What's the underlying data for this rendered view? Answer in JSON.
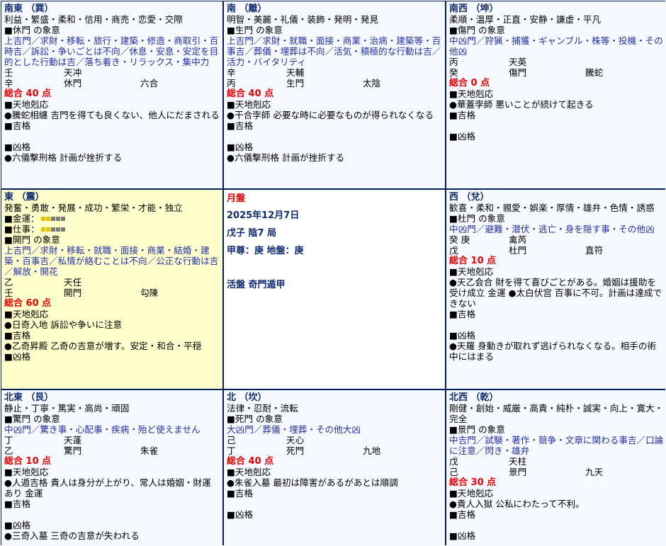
{
  "colors": {
    "border": "#00205a",
    "accent_blue": "#2130a8",
    "score_red": "#ee0000",
    "highlight": "#ffffcc",
    "luck_on": "#e8c400",
    "luck_off": "#7a7a7a"
  },
  "cells": {
    "se": {
      "title": "南東 （巽）",
      "traits": "利益・繁盛・柔和・信用・商売・恋愛・交際",
      "gate_label": "■休門 の象意",
      "gate_meaning": "上吉門／求財・移転・旅行・建築・修造・商取引・百時吉／訴訟・争いごとは不向／休息・安息・安定を目的とした行動は吉／落ち着き・リラックス・集中力",
      "row1": [
        "壬",
        "天冲",
        ""
      ],
      "row2": [
        "辛",
        "休門",
        "六合"
      ],
      "score": "総合 40 点",
      "kakusou": "■天地剋応",
      "kakusou_text": "●騰蛇相纏 吉門を得ても良くない、他人にだまされる",
      "kichi": "■吉格",
      "kichi_text": "",
      "kyou": "■凶格",
      "kyou_text": "●六儀撃刑格 計画が挫折する"
    },
    "s": {
      "title": "南 （離）",
      "traits": "明智・美麗・礼儀・装飾・発明・発見",
      "gate_label": "■生門 の象意",
      "gate_meaning": "上吉門／求財・就職・面接・商業・治病・建築等・百事吉／葬儀・埋葬は不向／活気・積極的な行動は吉／活力・バイタリティ",
      "row1": [
        "辛",
        "天輔",
        ""
      ],
      "row2": [
        "丙",
        "生門",
        "太陰"
      ],
      "score": "総合 40 点",
      "kakusou": "■天地剋応",
      "kakusou_text": "●干合孛師 必要な時に必要なものが得られなくなる",
      "kichi": "■吉格",
      "kichi_text": "",
      "kyou": "■凶格",
      "kyou_text": "●六儀撃刑格 計画が挫折する"
    },
    "sw": {
      "title": "南西 （坤）",
      "traits": "柔順・温厚・正直・安静・謙虚・平凡",
      "gate_label": "■傷門 の象意",
      "gate_meaning": "中凶門／狩猟・捕獲・ギャンブル・株等・投機・その他凶",
      "row1": [
        "丙",
        "天英",
        ""
      ],
      "row2": [
        "癸",
        "傷門",
        "騰蛇"
      ],
      "score": "総合 0 点",
      "kakusou": "■天地剋応",
      "kakusou_text": "●華蓋孛師 悪いことが続けて起きる",
      "kichi": "■吉格",
      "kichi_text": "",
      "kyou": "■凶格",
      "kyou_text": ""
    },
    "e": {
      "title": "東 （震）",
      "traits": "発奮・勇敢・発展・成功・繁栄・才能・独立",
      "luck1_label": "■金運：",
      "luck1_level": 2,
      "luck2_label": "■仕事：",
      "luck2_level": 2,
      "gate_label": "■開門 の象意",
      "gate_meaning": "上吉門／求財・移転・就職・面接・商業・結婚・建築・百事吉／私情が絡むことは不向／公正な行動は吉／解放・開花",
      "row1": [
        "乙",
        "天任",
        ""
      ],
      "row2": [
        "壬",
        "開門",
        "勾陳"
      ],
      "score": "総合 60 点",
      "kakusou": "■天地剋応",
      "kakusou_text": "●日奇入地 訴訟や争いに注意",
      "kichi": "■吉格",
      "kichi_text": "●乙奇昇殿 乙奇の吉意が増す。安定・和合・平穏",
      "kyou": "■凶格",
      "kyou_text": ""
    },
    "center": {
      "line1": "月盤",
      "line2": "2025年12月7日",
      "line3": "戊子 陰7 局",
      "line4": "甲尊：庚 地盤：庚",
      "line5": "活盤 奇門遁甲"
    },
    "w": {
      "title": "西 （兌）",
      "traits": "歓喜・柔和・親愛・娯楽・厚情・雄弁・色情・誘惑",
      "gate_label": "■杜門 の象意",
      "gate_meaning": "中凶門／避難・潜伏・逃亡・身を隠す事・その他凶",
      "row1": [
        "癸 庚",
        "禽芮",
        ""
      ],
      "row2": [
        "戊",
        "杜門",
        "直符"
      ],
      "score": "総合 10 点",
      "kakusou": "■天地剋応",
      "kakusou_text": "●天乙会合 財を得て喜びごとがある。婚姻は援助を受け成立 金運 ●太白伏宫 百事に不可。計画は達成できない",
      "kichi": "■吉格",
      "kichi_text": "",
      "kyou": "■凶格",
      "kyou_text": "●天羅 身動きが取れず逃げられなくなる。相手の術中にはまる"
    },
    "ne": {
      "title": "北東 （艮）",
      "traits": "静止・丁寧・篤実・高尚・頑固",
      "gate_label": "■驚門 の象意",
      "gate_meaning": "中凶門／驚き事・心配事・疾病・殆ど使えません",
      "row1": [
        "丁",
        "天蓬",
        ""
      ],
      "row2": [
        "乙",
        "驚門",
        "朱雀"
      ],
      "score": "総合 10 点",
      "kakusou": "■天地剋応",
      "kakusou_text": "●人遁吉格 貴人は身分が上がり、常人は婚姻・財運あり 金運",
      "kichi": "■吉格",
      "kichi_text": "",
      "kyou": "■凶格",
      "kyou_text": "●三奇入墓 三奇の吉意が失われる"
    },
    "n": {
      "title": "北 （坎）",
      "traits": "法律・忍耐・流転",
      "gate_label": "■死門 の象意",
      "gate_meaning": "大凶門／葬儀・埋葬・その他大凶",
      "row1": [
        "己",
        "天心",
        ""
      ],
      "row2": [
        "丁",
        "死門",
        "九地"
      ],
      "score": "総合 40 点",
      "kakusou": "■天地剋応",
      "kakusou_text": "●朱雀入墓 最初は障害があるがあとは順調",
      "kichi": "■吉格",
      "kichi_text": "",
      "kyou": "■凶格",
      "kyou_text": ""
    },
    "nw": {
      "title": "北西 （乾）",
      "traits": "剛健・創始・威厳・高貴・純朴・誠実・向上・寛大・完全",
      "gate_label": "■景門 の象意",
      "gate_meaning": "中吉門／試験・著作・競争・文章に関わる事吉／口論に注意／閃き・雄弁",
      "row1": [
        "戊",
        "天柱",
        ""
      ],
      "row2": [
        "己",
        "景門",
        "九天"
      ],
      "score": "総合 30 点",
      "kakusou": "■天地剋応",
      "kakusou_text": "●貴人入獄 公私にわたって不利。",
      "kichi": "■吉格",
      "kichi_text": "",
      "kyou": "■凶格",
      "kyou_text": ""
    }
  }
}
